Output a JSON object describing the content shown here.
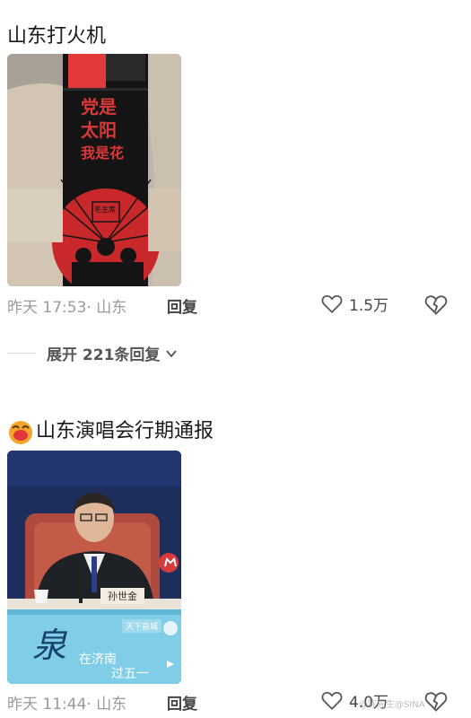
{
  "comments": [
    {
      "title": "山东打火机",
      "image": {
        "kind": "lighter-photo",
        "lines": [
          "党是",
          "太阳",
          "我是花"
        ],
        "badge": "毛主席",
        "colors": {
          "bg": "#c8c2b8",
          "lighter": "#1a1a1a",
          "accent": "#c8282a",
          "cap": "#e23a3a"
        }
      },
      "time": "昨天 17:53",
      "location": "山东",
      "reply_label": "回复",
      "likes": "1.5万"
    },
    {
      "title": "山东演唱会行期通报",
      "has_emoji": true,
      "image": {
        "kind": "press-conference",
        "nameplate": "孙世金",
        "banner_text": "在济南",
        "banner_text2": "过五一",
        "banner_char": "泉",
        "logo_text": "天下泉城",
        "colors": {
          "bg": "#1f2e5a",
          "banner": "#8fd3ea",
          "red": "#d43c3c"
        }
      },
      "time": "昨天 11:44",
      "location": "山东",
      "reply_label": "回复",
      "likes": "4.0万"
    }
  ],
  "expand_replies": "展开 221条回复",
  "watermark": "@陈先生@SINA"
}
